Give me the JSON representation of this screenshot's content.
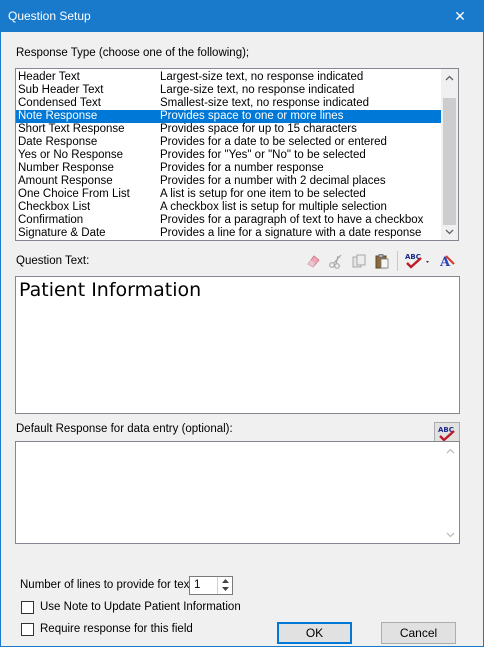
{
  "window": {
    "title": "Question Setup",
    "close_glyph": "✕"
  },
  "response_type": {
    "label": "Response Type (choose one of the following);",
    "selected_index": 3,
    "items": [
      {
        "name": "Header Text",
        "desc": "Largest-size text, no response indicated"
      },
      {
        "name": "Sub Header Text",
        "desc": "Large-size text, no response indicated"
      },
      {
        "name": "Condensed Text",
        "desc": "Smallest-size text, no response indicated"
      },
      {
        "name": "Note Response",
        "desc": "Provides space to one or more lines"
      },
      {
        "name": "Short Text Response",
        "desc": "Provides space for up to 15 characters"
      },
      {
        "name": "Date Response",
        "desc": "Provides for a date to be selected or entered"
      },
      {
        "name": "Yes or No Response",
        "desc": "Provides for \"Yes\" or \"No\" to be selected"
      },
      {
        "name": "Number Response",
        "desc": "Provides for a number response"
      },
      {
        "name": "Amount Response",
        "desc": "Provides for a number with 2 decimal places"
      },
      {
        "name": "One Choice From List",
        "desc": "A list is setup for one item to be selected"
      },
      {
        "name": "Checkbox List",
        "desc": "A checkbox list is setup for multiple selection"
      },
      {
        "name": "Confirmation",
        "desc": "Provides for a paragraph of text to have a checkbox"
      },
      {
        "name": "Signature & Date",
        "desc": "Provides a line for a signature with a date response"
      }
    ]
  },
  "question": {
    "label": "Question Text:",
    "value": "Patient Information"
  },
  "toolbar": {
    "icons": [
      "eraser-icon",
      "scissors-icon",
      "copy-icon",
      "paste-icon",
      "spellcheck-icon",
      "font-icon"
    ]
  },
  "default_response": {
    "label": "Default Response for data entry (optional):",
    "value": ""
  },
  "lines": {
    "label": "Number of lines to provide for text:",
    "value": "1"
  },
  "options": {
    "use_note_label": "Use Note to Update Patient Information",
    "use_note_checked": false,
    "require_label": "Require response for this field",
    "require_checked": false
  },
  "buttons": {
    "ok": "OK",
    "cancel": "Cancel"
  },
  "colors": {
    "titlebar": "#1979ca",
    "selection": "#0078d7"
  }
}
